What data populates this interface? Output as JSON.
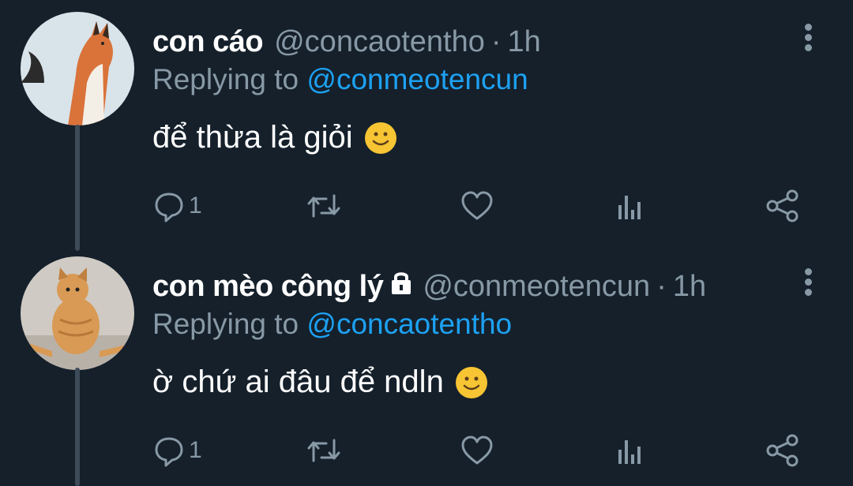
{
  "tweets": [
    {
      "display_name": "con cáo",
      "handle": "@concaotentho",
      "separator": "·",
      "time": "1h",
      "replying_prefix": "Replying to",
      "replying_to": "@conmeotencun",
      "text": "để thừa là giỏi",
      "emoji": "slightly-smiling-face",
      "reply_count": "1",
      "verified_lock": false
    },
    {
      "display_name": "con mèo công lý",
      "handle": "@conmeotencun",
      "separator": "·",
      "time": "1h",
      "replying_prefix": "Replying to",
      "replying_to": "@concaotentho",
      "text": "ờ chứ ai đâu để ndln",
      "emoji": "slightly-smiling-face",
      "reply_count": "1",
      "verified_lock": true
    }
  ],
  "colors": {
    "background": "#15202b",
    "text": "#ffffff",
    "muted": "#8899a6",
    "link": "#1da1f2",
    "thread_line": "#3d4a57"
  },
  "icons": {
    "reply": "reply-icon",
    "retweet": "retweet-icon",
    "like": "heart-icon",
    "analytics": "analytics-icon",
    "share": "share-icon",
    "more": "more-vertical-icon",
    "lock": "lock-icon"
  }
}
